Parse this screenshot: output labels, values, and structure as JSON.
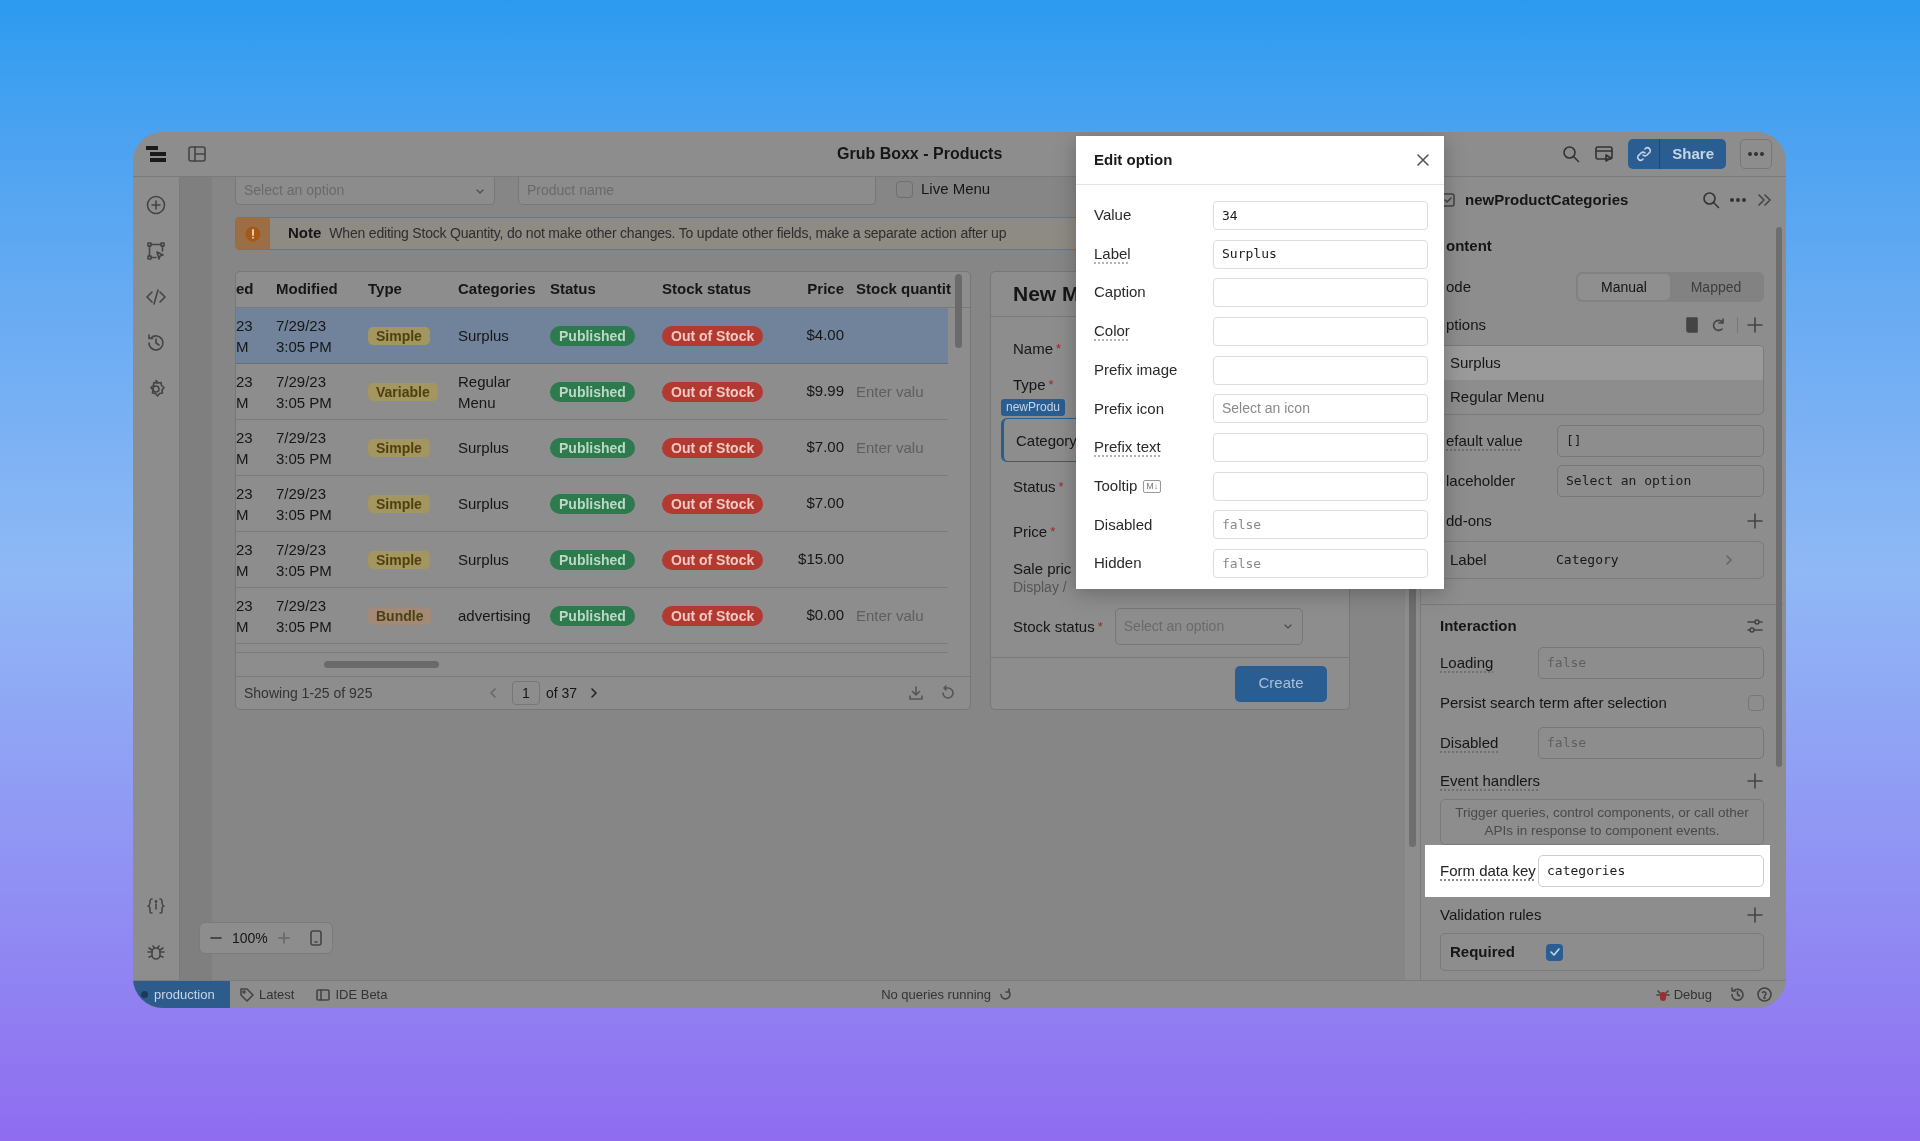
{
  "top_bar": {
    "title": "Grub Boxx - Products",
    "share": "Share"
  },
  "filters": {
    "select_placeholder": "Select an option",
    "search_placeholder": "Product name",
    "live_menu": {
      "label": "Live Menu",
      "checked": false
    }
  },
  "note": {
    "label": "Note",
    "text": "When editing Stock Quantity, do not make other changes. To update other fields, make a separate action after up"
  },
  "table": {
    "columns": [
      "ed",
      "Modified",
      "Type",
      "Categories",
      "Status",
      "Stock status",
      "Price",
      "Stock quantit"
    ],
    "rows": [
      {
        "selected": true,
        "cut_date": "23",
        "cut_time": "M",
        "modified_date": "7/29/23",
        "modified_time": "3:05 PM",
        "type": {
          "label": "Simple",
          "color": "#a39660"
        },
        "categories": "Surplus",
        "status": "Published",
        "stock_status": "Out of Stock",
        "price": "$4.00"
      },
      {
        "selected": false,
        "cut_date": "23",
        "cut_time": "M",
        "modified_date": "7/29/23",
        "modified_time": "3:05 PM",
        "type": {
          "label": "Variable",
          "color": "#a39660"
        },
        "categories": "Regular Menu",
        "status": "Published",
        "stock_status": "Out of Stock",
        "price": "$9.99",
        "stock_quantity_placeholder": "Enter valu"
      },
      {
        "selected": false,
        "cut_date": "23",
        "cut_time": "M",
        "modified_date": "7/29/23",
        "modified_time": "3:05 PM",
        "type": {
          "label": "Simple",
          "color": "#a39660"
        },
        "categories": "Surplus",
        "status": "Published",
        "stock_status": "Out of Stock",
        "price": "$7.00",
        "stock_quantity_placeholder": "Enter valu"
      },
      {
        "selected": false,
        "cut_date": "23",
        "cut_time": "M",
        "modified_date": "7/29/23",
        "modified_time": "3:05 PM",
        "type": {
          "label": "Simple",
          "color": "#a39660"
        },
        "categories": "Surplus",
        "status": "Published",
        "stock_status": "Out of Stock",
        "price": "$7.00"
      },
      {
        "selected": false,
        "cut_date": "23",
        "cut_time": "M",
        "modified_date": "7/29/23",
        "modified_time": "3:05 PM",
        "type": {
          "label": "Simple",
          "color": "#a39660"
        },
        "categories": "Surplus",
        "status": "Published",
        "stock_status": "Out of Stock",
        "price": "$15.00"
      },
      {
        "selected": false,
        "cut_date": "23",
        "cut_time": "M",
        "modified_date": "7/29/23",
        "modified_time": "3:05 PM",
        "type": {
          "label": "Bundle",
          "color": "#a38a78"
        },
        "categories": "advertising",
        "status": "Published",
        "stock_status": "Out of Stock",
        "price": "$0.00",
        "stock_quantity_placeholder": "Enter valu"
      }
    ],
    "pagination": {
      "summary": "Showing 1-25 of 925",
      "page": "1",
      "total": "of 37"
    }
  },
  "form": {
    "title": "New M",
    "required_mark": "*",
    "tag": "newProdu",
    "fields": [
      {
        "label": "Name",
        "required": true
      },
      {
        "label": "Type",
        "required": true
      },
      {
        "label": "Category",
        "required": false,
        "selected": true
      },
      {
        "label": "Status",
        "required": true
      },
      {
        "label": "Price",
        "required": true
      },
      {
        "label": "Sale pric",
        "required": false,
        "caption": "Display /"
      },
      {
        "label": "Stock status",
        "required": true,
        "placeholder": "Select an option"
      }
    ],
    "submit": "Create"
  },
  "modal": {
    "title": "Edit option",
    "fields": [
      {
        "label": "Value",
        "kind": "code",
        "value": "34",
        "hint": false
      },
      {
        "label": "Label",
        "kind": "code",
        "value": "Surplus",
        "hint": true
      },
      {
        "label": "Caption",
        "kind": "code",
        "hint": false
      },
      {
        "label": "Color",
        "kind": "code",
        "hint": true
      },
      {
        "label": "Prefix image",
        "kind": "code",
        "hint": false
      },
      {
        "label": "Prefix icon",
        "kind": "select",
        "placeholder": "Select an icon",
        "hint": false
      },
      {
        "label": "Prefix text",
        "kind": "code",
        "hint": true
      },
      {
        "label": "Tooltip",
        "kind": "code",
        "badge": "M↓",
        "hint": false
      },
      {
        "label": "Disabled",
        "kind": "code",
        "placeholder": "false",
        "hint": false
      },
      {
        "label": "Hidden",
        "kind": "code",
        "placeholder": "false",
        "hint": false
      }
    ]
  },
  "inspector": {
    "title": "newProductCategories",
    "content_heading": "ontent",
    "mode": {
      "label": "ode",
      "options": [
        {
          "label": "Manual",
          "selected": true
        },
        {
          "label": "Mapped",
          "selected": false
        }
      ]
    },
    "options": {
      "label": "ptions",
      "items": [
        {
          "label": "Surplus",
          "selected": true
        },
        {
          "label": "Regular Menu",
          "selected": false
        }
      ]
    },
    "default_value": {
      "label": "efault value",
      "value": "[]"
    },
    "placeholder": {
      "label": "laceholder",
      "value": "Select an option"
    },
    "addons": {
      "label": "dd-ons",
      "items": [
        {
          "label": "Label",
          "value": "Category"
        }
      ]
    },
    "interaction_heading": "Interaction",
    "loading": {
      "label": "Loading",
      "placeholder": "false"
    },
    "persist": {
      "label": "Persist search term after selection",
      "checked": false
    },
    "disabled": {
      "label": "Disabled",
      "placeholder": "false"
    },
    "event_handlers": {
      "label": "Event handlers",
      "empty_text": "Trigger queries, control components, or call other APIs in response to component events."
    },
    "form_data_key": {
      "label": "Form data key",
      "value": "categories",
      "highlighted": true
    },
    "validation": {
      "label": "Validation rules",
      "items": [
        {
          "label": "Required",
          "checked": true
        }
      ]
    }
  },
  "zoom": {
    "level_text": "100%"
  },
  "status_bar": {
    "environment": "production",
    "branch": "Latest",
    "ide": "IDE Beta",
    "queries": "No queries running",
    "debug": "Debug"
  }
}
